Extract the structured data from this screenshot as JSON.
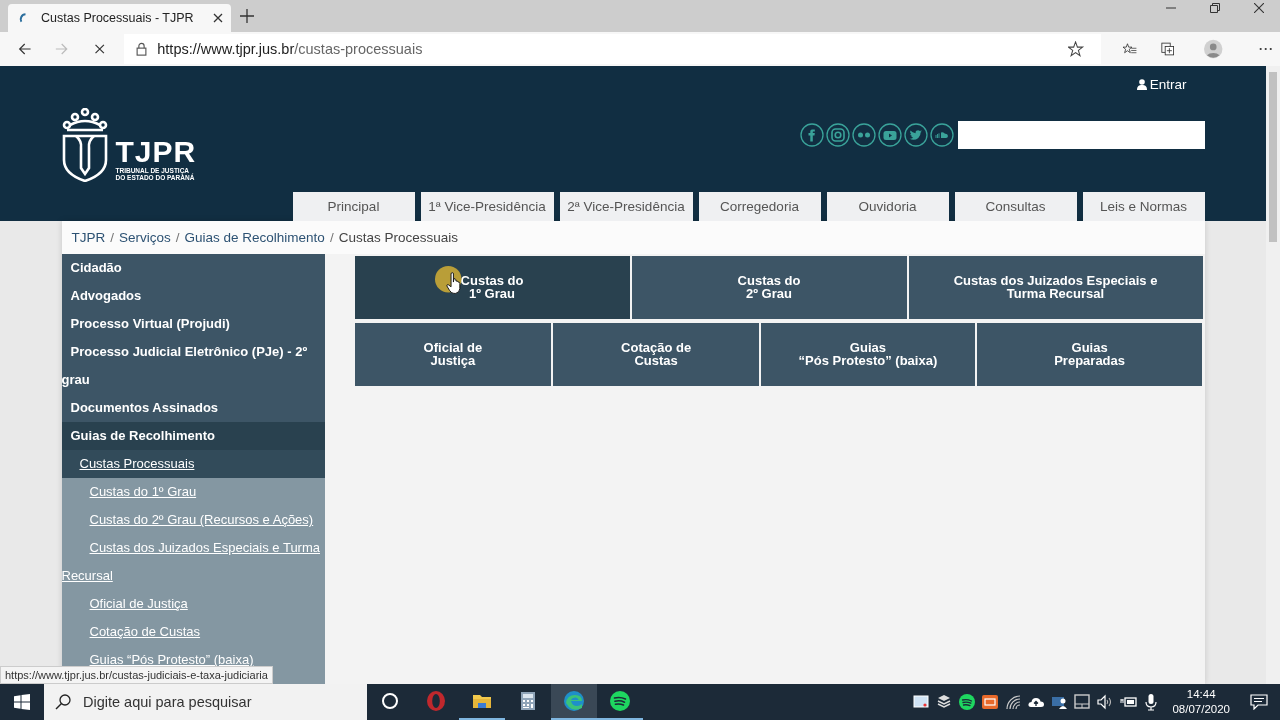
{
  "browser": {
    "tab_title": "Custas Processuais - TJPR",
    "url_host": "https://www.tjpr.jus.br",
    "url_path": "/custas-processuais"
  },
  "header": {
    "login": "Entrar",
    "logo_text": "TJPR",
    "logo_subtitle": [
      "TRIBUNAL DE JUSTIÇA",
      "DO ESTADO DO PARANÁ"
    ],
    "social": [
      {
        "kind": "facebook"
      },
      {
        "kind": "instagram"
      },
      {
        "kind": "flickr"
      },
      {
        "kind": "youtube"
      },
      {
        "kind": "twitter"
      },
      {
        "kind": "soundcloud"
      }
    ],
    "nav": [
      "Principal",
      "1ª Vice-Presidência",
      "2ª Vice-Presidência",
      "Corregedoria",
      "Ouvidoria",
      "Consultas",
      "Leis e Normas"
    ]
  },
  "breadcrumb": {
    "separator": "/",
    "items": [
      {
        "label": "TJPR",
        "link": true
      },
      {
        "label": "Serviços",
        "link": true
      },
      {
        "label": "Guias de Recolhimento",
        "link": true
      },
      {
        "label": "Custas Processuais",
        "link": false
      }
    ]
  },
  "sidebar": {
    "items": [
      {
        "label": "Cidadão",
        "selected": false
      },
      {
        "label": "Advogados",
        "selected": false
      },
      {
        "label": "Processo Virtual (Projudi)",
        "selected": false
      },
      {
        "label": "Processo Judicial Eletrônico (PJe) - 2º grau",
        "selected": false
      },
      {
        "label": "Documentos Assinados",
        "selected": false
      },
      {
        "label": "Guias de Recolhimento",
        "selected": true,
        "children": [
          {
            "label": "Custas Processuais",
            "selected": true,
            "children": [
              {
                "label": "Custas do 1º Grau",
                "selected": false
              },
              {
                "label": "Custas do 2º Grau (Recursos e Ações)",
                "selected": false
              },
              {
                "label": "Custas dos Juizados Especiais e Turma Recursal",
                "selected": false
              },
              {
                "label": "Oficial de Justiça",
                "selected": false
              },
              {
                "label": "Cotação de Custas",
                "selected": false
              },
              {
                "label": "Guias “Pós Protesto” (baixa)",
                "selected": false
              }
            ]
          }
        ]
      }
    ]
  },
  "tiles": [
    [
      {
        "lines": [
          "Custas do",
          "1º Grau"
        ],
        "hovered": true
      },
      {
        "lines": [
          "Custas do",
          "2º Grau"
        ],
        "hovered": false
      },
      {
        "lines": [
          "Custas dos Juizados Especiais e",
          "Turma Recursal"
        ],
        "hovered": false
      }
    ],
    [
      {
        "lines": [
          "Oficial de",
          "Justiça"
        ],
        "hovered": false
      },
      {
        "lines": [
          "Cotação de",
          "Custas"
        ],
        "hovered": false
      },
      {
        "lines": [
          "Guias",
          "“Pós Protesto” (baixa)"
        ],
        "hovered": false
      },
      {
        "lines": [
          "Guias",
          "Preparadas"
        ],
        "hovered": false
      }
    ]
  ],
  "status_url": "https://www.tjpr.jus.br/custas-judiciais-e-taxa-judiciaria",
  "taskbar": {
    "search_placeholder": "Digite aqui para pesquisar",
    "apps": [
      {
        "kind": "cortana",
        "running": false,
        "selected": false
      },
      {
        "kind": "opera",
        "running": false,
        "selected": false
      },
      {
        "kind": "folder",
        "running": true,
        "selected": false
      },
      {
        "kind": "calculator",
        "running": false,
        "selected": false
      },
      {
        "kind": "edge",
        "running": true,
        "selected": true
      },
      {
        "kind": "spotify",
        "running": true,
        "selected": false
      }
    ],
    "tray": [
      {
        "kind": "monitor"
      },
      {
        "kind": "stack"
      },
      {
        "kind": "spotify"
      },
      {
        "kind": "badge"
      },
      {
        "kind": "wifi"
      },
      {
        "kind": "cloud"
      },
      {
        "kind": "people"
      },
      {
        "kind": "touchpad"
      },
      {
        "kind": "volume"
      },
      {
        "kind": "battery"
      },
      {
        "kind": "mic"
      }
    ],
    "time": "14:44",
    "date": "08/07/2020"
  }
}
